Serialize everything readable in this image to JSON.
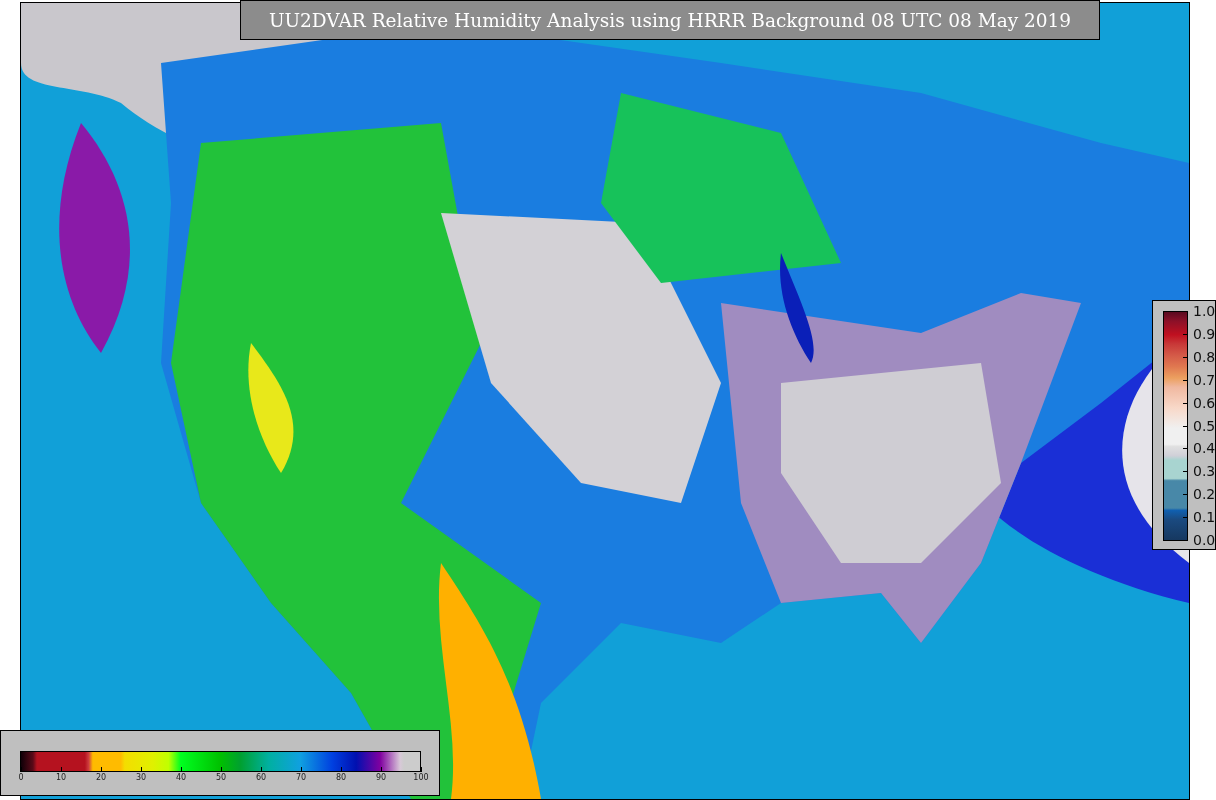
{
  "title": "UU2DVAR Relative Humidity Analysis using HRRR Background 08 UTC 08 May 2019",
  "humidity_colorbar": {
    "ticks": [
      "0",
      "10",
      "20",
      "30",
      "40",
      "50",
      "60",
      "70",
      "80",
      "90",
      "100"
    ]
  },
  "ratio_colorbar": {
    "ticks": [
      "1.0",
      "0.9",
      "0.8",
      "0.7",
      "0.6",
      "0.5",
      "0.4",
      "0.3",
      "0.2",
      "0.1",
      "0.0"
    ]
  }
}
